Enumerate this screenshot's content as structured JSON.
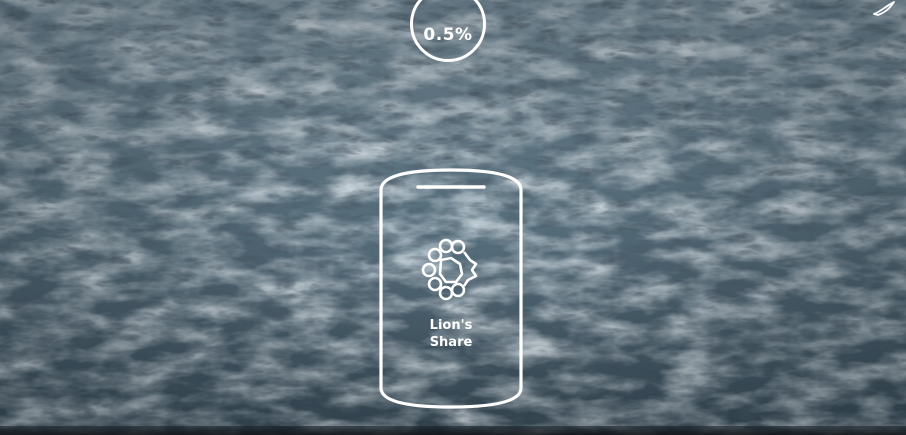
{
  "scene": {
    "background_description_color": "#50697a",
    "accent_color": "#ffffff"
  },
  "badge": {
    "value": "0.5%",
    "icon": "circle-outline"
  },
  "jar": {
    "icon": "lions-share-logo-icon",
    "label_line1": "Lion's",
    "label_line2": "Share"
  },
  "corner": {
    "icon": "bird-logo-icon"
  }
}
